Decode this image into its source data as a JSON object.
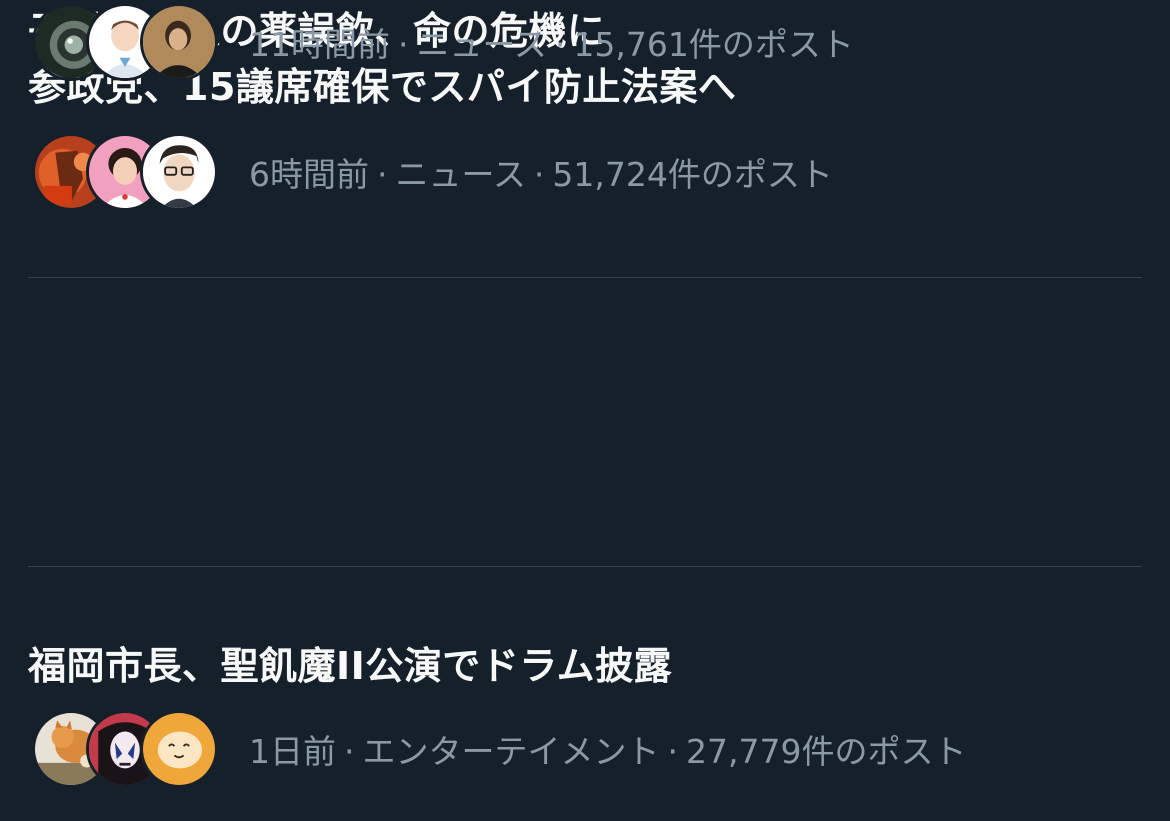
{
  "trends": [
    {
      "title": "参政党、15議席確保でスパイ防止法案へ",
      "time": "6時間前",
      "category": "ニュース",
      "posts": "51,724件のポスト",
      "separator": "·",
      "avatars": [
        "avatar-orange-figure",
        "avatar-woman-pink",
        "avatar-man-glasses-illustration"
      ]
    },
    {
      "title": "福岡市長、聖飢魔II公演でドラム披露",
      "time": "1日前",
      "category": "エンターテイメント",
      "posts": "27,779件のポスト",
      "separator": "·",
      "avatars": [
        "avatar-cat",
        "avatar-face-paint",
        "avatar-yellow-blob"
      ]
    },
    {
      "title": "子供が大人の薬誤飲、命の危機に",
      "time": "11時間前",
      "category": "ニュース",
      "posts": "15,761件のポスト",
      "separator": "·",
      "avatars": [
        "avatar-camera-lens",
        "avatar-doctor-illustration",
        "avatar-person-photo"
      ]
    }
  ],
  "colors": {
    "background": "#15202b",
    "title": "#f7f9f9",
    "meta": "#8b98a5",
    "divider": "#38444d"
  }
}
